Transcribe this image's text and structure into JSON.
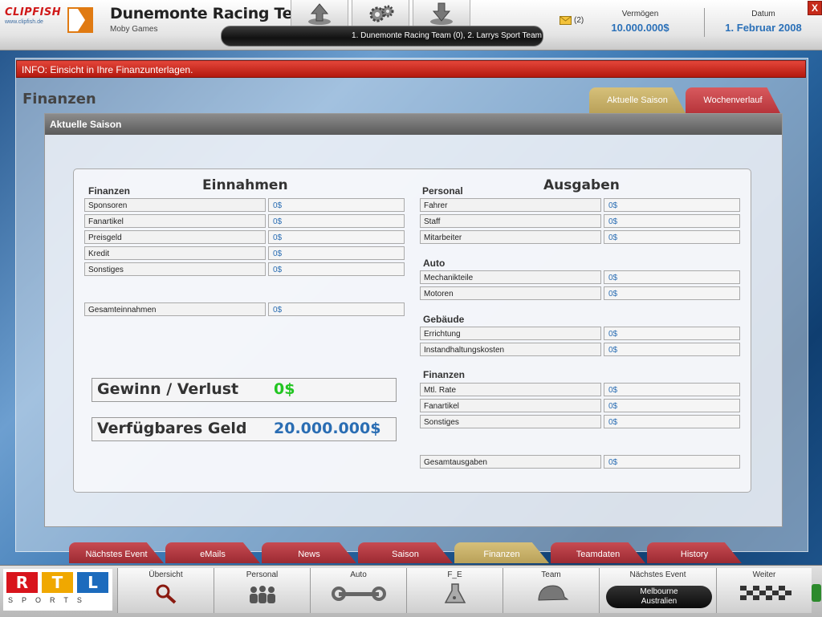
{
  "header": {
    "clipfish_logo": "CLIPFISH",
    "clipfish_url": "www.clipfish.de",
    "team_name": "Dunemonte Racing Team",
    "company": "Moby Games",
    "ticker": "1. Dunemonte Racing Team (0),     2. Larrys Sport Team",
    "mail_count": "(2)",
    "wealth_label": "Vermögen",
    "wealth_value": "10.000.000$",
    "date_label": "Datum",
    "date_value": "1. Februar 2008",
    "close_label": "X"
  },
  "info": "INFO: Einsicht in Ihre Finanzunterlagen.",
  "section_title": "Finanzen",
  "tabs": [
    "Aktuelle Saison",
    "Wochenverlauf"
  ],
  "panel_title": "Aktuelle Saison",
  "income": {
    "title": "Einnahmen",
    "group": "Finanzen",
    "rows": [
      {
        "label": "Sponsoren",
        "value": "0$"
      },
      {
        "label": "Fanartikel",
        "value": "0$"
      },
      {
        "label": "Preisgeld",
        "value": "0$"
      },
      {
        "label": "Kredit",
        "value": "0$"
      },
      {
        "label": "Sonstiges",
        "value": "0$"
      }
    ],
    "total": {
      "label": "Gesamteinnahmen",
      "value": "0$"
    }
  },
  "expenses": {
    "title": "Ausgaben",
    "groups": [
      {
        "name": "Personal",
        "rows": [
          {
            "label": "Fahrer",
            "value": "0$"
          },
          {
            "label": "Staff",
            "value": "0$"
          },
          {
            "label": "Mitarbeiter",
            "value": "0$"
          }
        ]
      },
      {
        "name": "Auto",
        "rows": [
          {
            "label": "Mechanikteile",
            "value": "0$"
          },
          {
            "label": "Motoren",
            "value": "0$"
          }
        ]
      },
      {
        "name": "Gebäude",
        "rows": [
          {
            "label": "Errichtung",
            "value": "0$"
          },
          {
            "label": "Instandhaltungskosten",
            "value": "0$"
          }
        ]
      },
      {
        "name": "Finanzen",
        "rows": [
          {
            "label": "Mtl. Rate",
            "value": "0$"
          },
          {
            "label": "Fanartikel",
            "value": "0$"
          },
          {
            "label": "Sonstiges",
            "value": "0$"
          }
        ]
      }
    ],
    "total": {
      "label": "Gesamtausgaben",
      "value": "0$"
    }
  },
  "profit": {
    "label": "Gewinn / Verlust",
    "value": "0$"
  },
  "available": {
    "label": "Verfügbares Geld",
    "value": "20.000.000$"
  },
  "lower_tabs": [
    "Nächstes Event",
    "eMails",
    "News",
    "Saison",
    "Finanzen",
    "Teamdaten",
    "History"
  ],
  "bottom_nav": [
    "Übersicht",
    "Personal",
    "Auto",
    "F_E",
    "Team",
    "Nächstes Event",
    "Weiter"
  ],
  "next_event": {
    "city": "Melbourne",
    "country": "Australien"
  },
  "rtl": {
    "letters": [
      "R",
      "T",
      "L"
    ],
    "sports": "SPORTS"
  },
  "colors": {
    "value_blue": "#2a6db3",
    "profit_green": "#22c522",
    "info_red": "#c8281c",
    "active_tab": "#c9b26a",
    "tab_red": "#b3363c"
  }
}
